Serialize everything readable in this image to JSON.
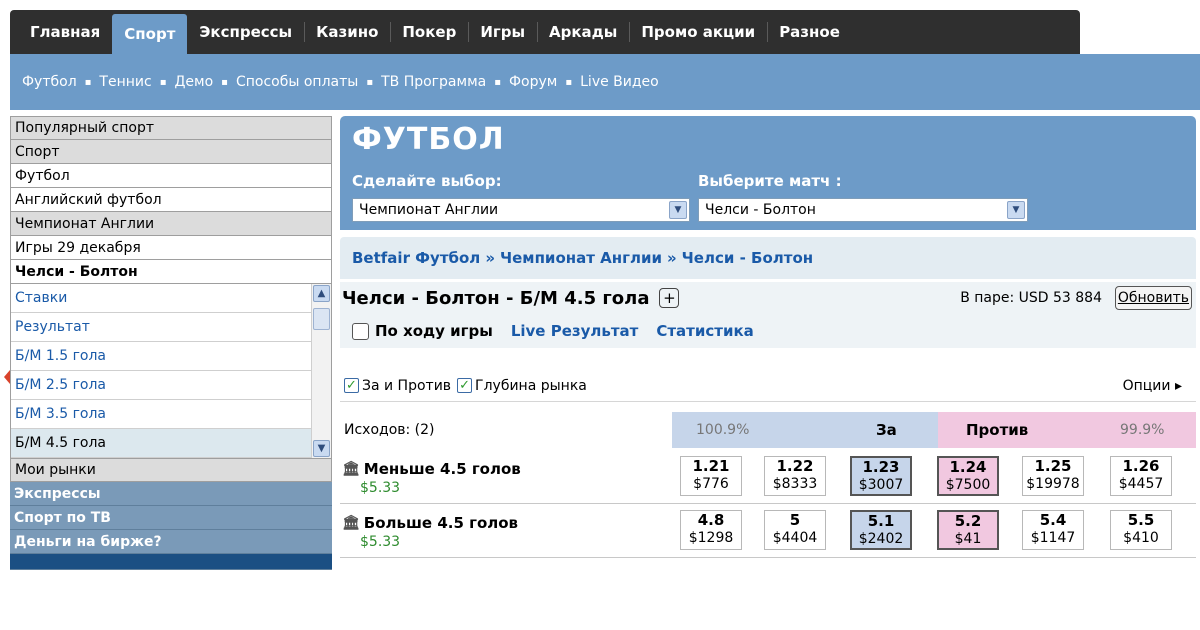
{
  "nav": {
    "tabs": [
      "Главная",
      "Спорт",
      "Экспрессы",
      "Казино",
      "Покер",
      "Игры",
      "Аркады",
      "Промо акции",
      "Разное"
    ],
    "active_tab": 1,
    "subnav": [
      "Футбол",
      "Теннис",
      "Демо",
      "Способы оплаты",
      "ТВ Программа",
      "Форум",
      "Live Видео"
    ],
    "subnav_sep": "▪"
  },
  "sidebar": {
    "header_rows": [
      "Популярный спорт",
      "Спорт",
      "Футбол",
      "Английский футбол",
      "Чемпионат Англии",
      "Игры 29 декабря"
    ],
    "current": "Челси - Болтон",
    "list_items": [
      "Ставки",
      "Результат",
      "Б/М 1.5 гола",
      "Б/М 2.5 гола",
      "Б/М 3.5 гола",
      "Б/М 4.5 гола"
    ],
    "selected_index": 5,
    "my_markets": "Мои рынки",
    "sections": [
      "Экспрессы",
      "Спорт по ТВ",
      "Деньги на бирже?"
    ]
  },
  "hero": {
    "title": "ФУТБОЛ",
    "choose_label": "Сделайте выбор:",
    "choose_value": "Чемпионат Англии",
    "match_label": "Выберите матч :",
    "match_value": "Челси - Болтон"
  },
  "breadcrumb": [
    "Betfair Футбол",
    "Чемпионат Англии",
    "Челси - Болтон"
  ],
  "breadcrumb_sep": "»",
  "market": {
    "title": "Челси - Болтон - Б/М 4.5 гола",
    "plus": "+",
    "matched": "В паре: USD 53 884",
    "refresh": "Обновить",
    "in_play": "По ходу игры",
    "live_results": "Live Результат",
    "statistics": "Статистика",
    "opt_back_lay": "За и Против",
    "opt_depth": "Глубина рынка",
    "options": "Опции ▸",
    "runners_label": "Исходов: (2)",
    "back_pct": "100.9%",
    "back_label": "За",
    "lay_label": "Против",
    "lay_pct": "99.9%"
  },
  "runners": [
    {
      "name": "Меньше 4.5 голов",
      "pl": "$5.33",
      "prices": [
        {
          "odds": "1.21",
          "amount": "$776"
        },
        {
          "odds": "1.22",
          "amount": "$8333"
        },
        {
          "odds": "1.23",
          "amount": "$3007"
        },
        {
          "odds": "1.24",
          "amount": "$7500"
        },
        {
          "odds": "1.25",
          "amount": "$19978"
        },
        {
          "odds": "1.26",
          "amount": "$4457"
        }
      ]
    },
    {
      "name": "Больше 4.5 голов",
      "pl": "$5.33",
      "prices": [
        {
          "odds": "4.8",
          "amount": "$1298"
        },
        {
          "odds": "5",
          "amount": "$4404"
        },
        {
          "odds": "5.1",
          "amount": "$2402"
        },
        {
          "odds": "5.2",
          "amount": "$41"
        },
        {
          "odds": "5.4",
          "amount": "$1147"
        },
        {
          "odds": "5.5",
          "amount": "$410"
        }
      ]
    }
  ],
  "colors": {
    "accent": "#6d9bc8",
    "back": "#c6d5ea",
    "lay": "#f1c8e0",
    "link": "#1a5aa8",
    "profit": "#2e8b2e"
  }
}
